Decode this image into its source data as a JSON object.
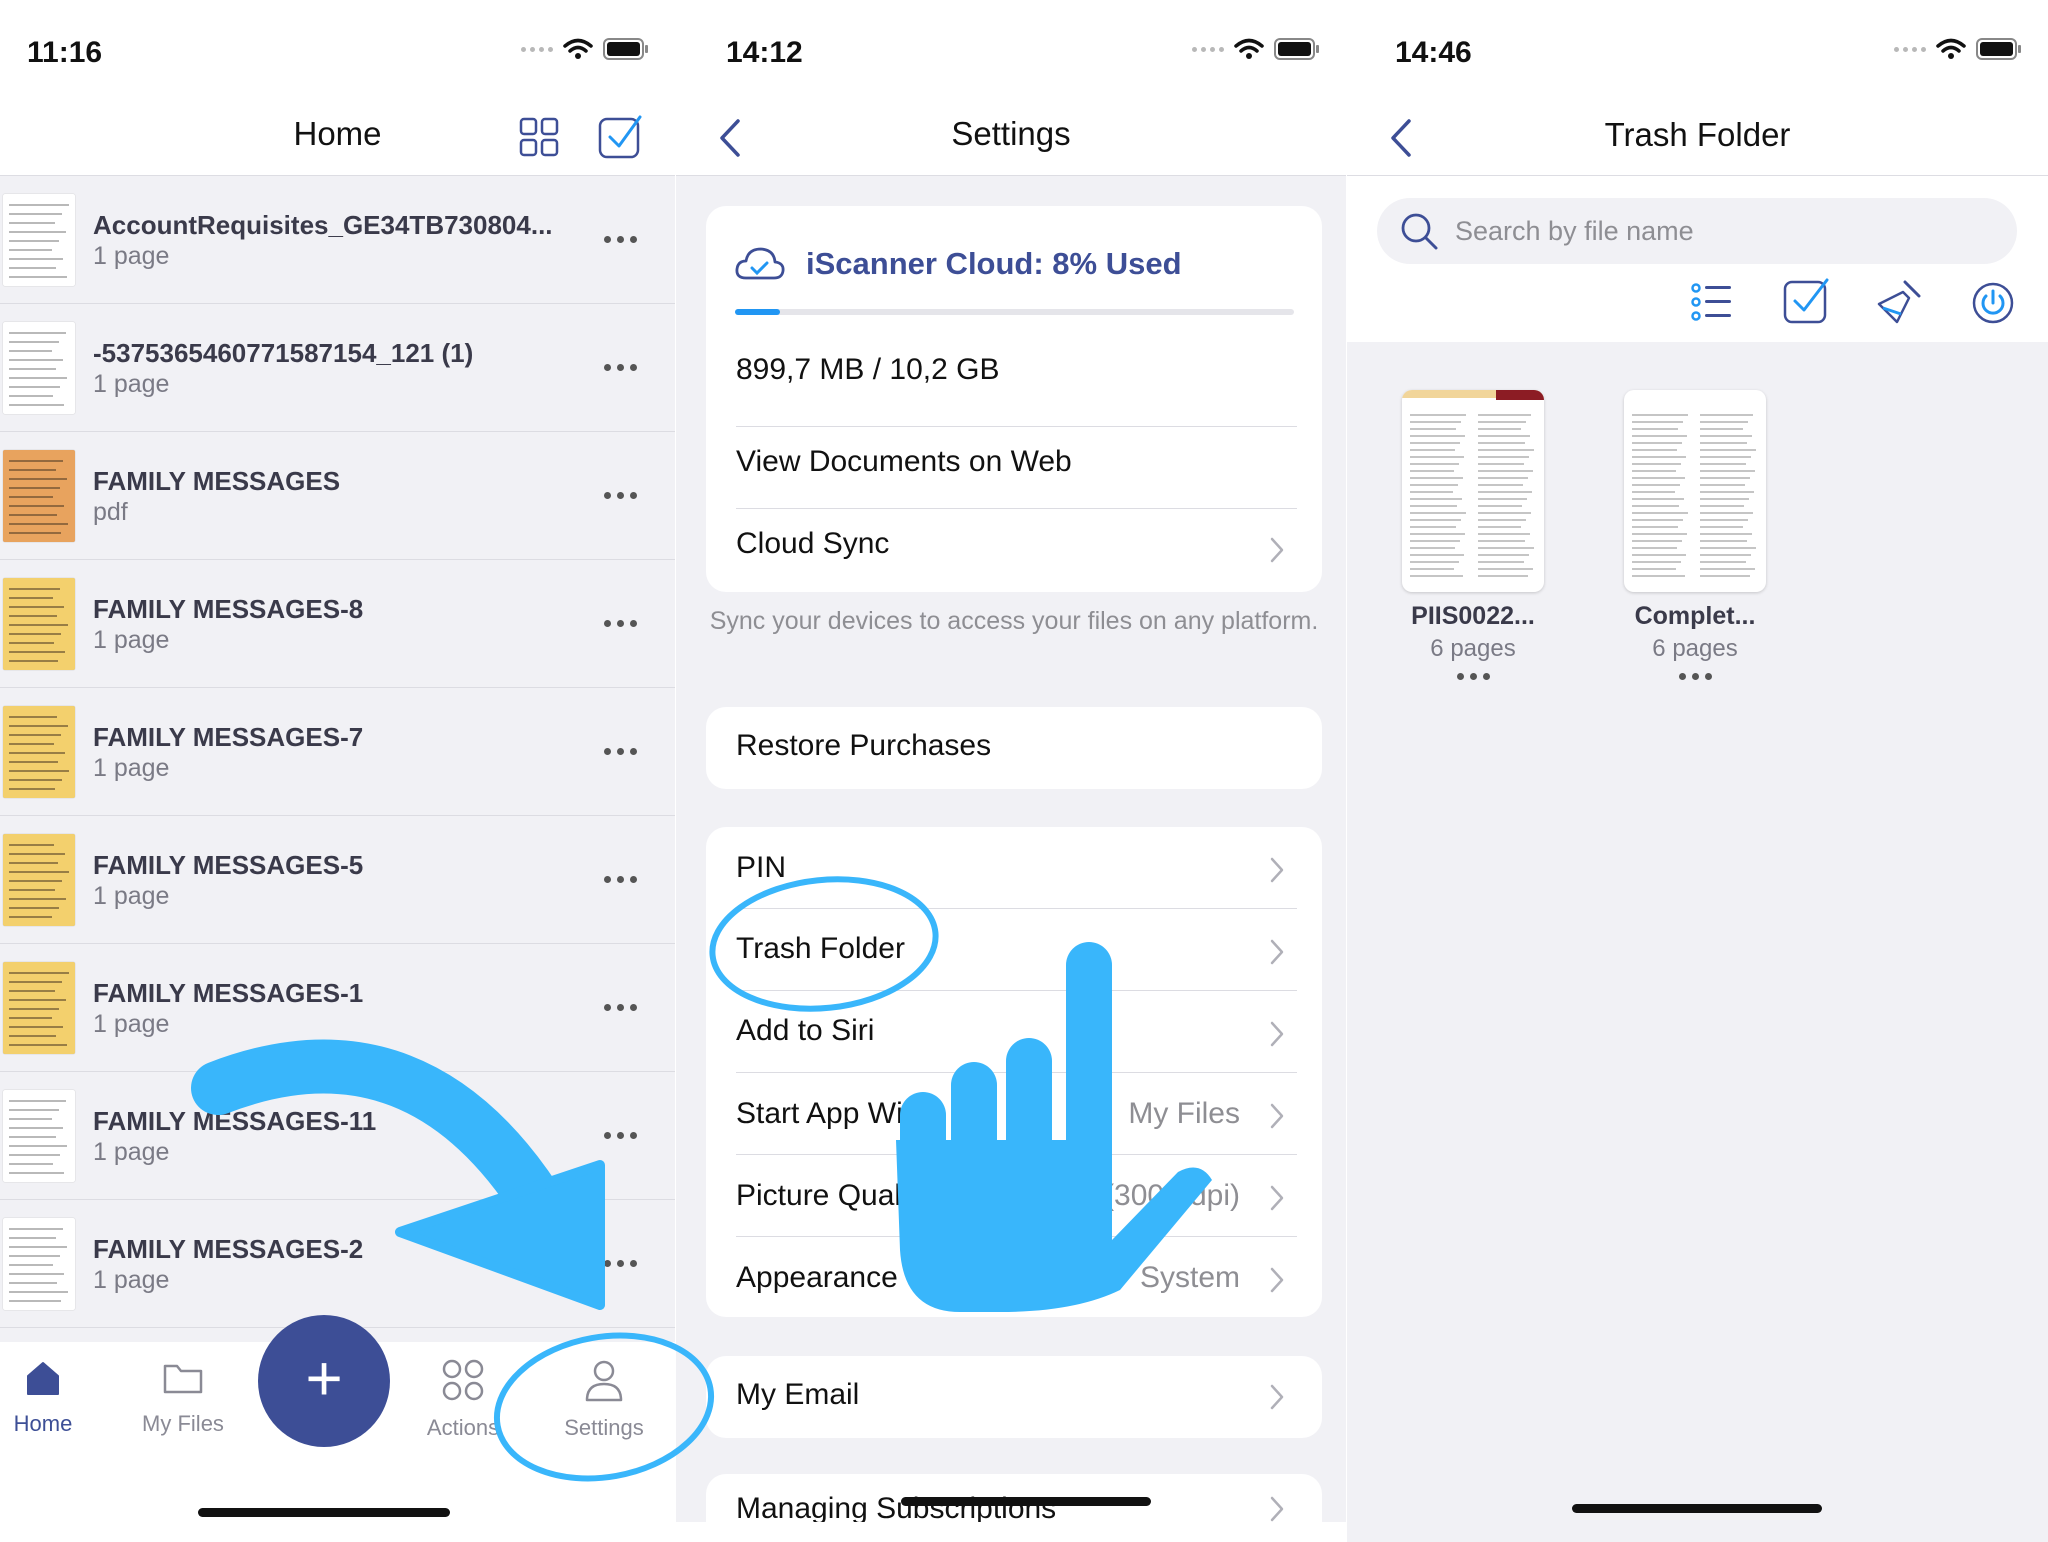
{
  "screens": {
    "home": {
      "status_time": "11:16",
      "title": "Home",
      "documents": [
        {
          "name": "AccountRequisites_GE34TB730804...",
          "sub": "1 page",
          "thumb": "doc"
        },
        {
          "name": "-5375365460771587154_121 (1)",
          "sub": "1 page",
          "thumb": "doc"
        },
        {
          "name": "FAMILY MESSAGES",
          "sub": "pdf",
          "thumb": "orange"
        },
        {
          "name": "FAMILY MESSAGES-8",
          "sub": "1 page",
          "thumb": "yellow"
        },
        {
          "name": "FAMILY MESSAGES-7",
          "sub": "1 page",
          "thumb": "yellow"
        },
        {
          "name": "FAMILY MESSAGES-5",
          "sub": "1 page",
          "thumb": "yellow"
        },
        {
          "name": "FAMILY MESSAGES-1",
          "sub": "1 page",
          "thumb": "yellow"
        },
        {
          "name": "FAMILY MESSAGES-11",
          "sub": "1 page",
          "thumb": "doc"
        },
        {
          "name": "FAMILY MESSAGES-2",
          "sub": "1 page",
          "thumb": "doc"
        }
      ],
      "tabs": {
        "home": "Home",
        "my_files": "My Files",
        "add": "+",
        "actions": "Actions",
        "settings": "Settings"
      }
    },
    "settings": {
      "status_time": "14:12",
      "title": "Settings",
      "cloud": {
        "title": "iScanner Cloud: 8% Used",
        "used_fraction": 0.08,
        "storage": "899,7 MB / 10,2 GB",
        "view_web": "View Documents on Web",
        "cloud_sync": "Cloud Sync",
        "footer": "Sync your devices to access your files on any platform."
      },
      "restore": "Restore Purchases",
      "rows": {
        "pin": "PIN",
        "trash": "Trash Folder",
        "siri": "Add to Siri",
        "start_app": "Start App With",
        "start_app_value": "My Files",
        "picture_quality": "Picture Quality",
        "picture_quality_value": "(300+ dpi)",
        "appearance": "Appearance",
        "appearance_value": "System"
      },
      "my_email": "My Email",
      "managing": "Managing Subscriptions"
    },
    "trash": {
      "status_time": "14:46",
      "title": "Trash Folder",
      "search_placeholder": "Search by file name",
      "files": [
        {
          "name": "PIIS0022...",
          "sub": "6 pages"
        },
        {
          "name": "Complet...",
          "sub": "6 pages"
        }
      ]
    }
  },
  "colors": {
    "accent": "#3d4e96",
    "annotation": "#39b6fb",
    "progress": "#2196f3",
    "background": "#f1f1f5"
  },
  "icons": {
    "status": [
      "signal-dots-icon",
      "wifi-icon",
      "battery-icon"
    ],
    "home_nav": [
      "grid-view-icon",
      "select-checkbox-icon"
    ],
    "trash_tools": [
      "list-view-icon",
      "select-checkbox-icon",
      "broom-clean-icon",
      "power-icon"
    ],
    "annotations": [
      "curved-arrow-icon",
      "pointing-hand-icon"
    ]
  }
}
